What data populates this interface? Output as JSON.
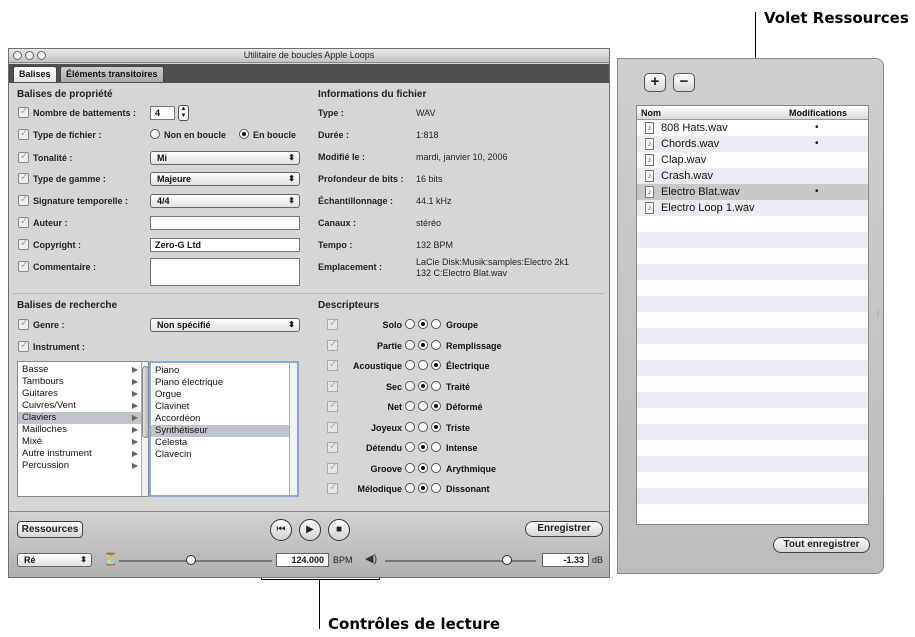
{
  "callouts": {
    "resources": "Volet Ressources",
    "playback": "Contrôles de lecture"
  },
  "window": {
    "title": "Utilitaire de boucles Apple Loops",
    "tabs": [
      "Balises",
      "Éléments transitoires"
    ]
  },
  "property_tags": {
    "title": "Balises de propriété",
    "beats_label": "Nombre de battements :",
    "beats_value": "4",
    "file_type_label": "Type de fichier :",
    "file_type_opt1": "Non en boucle",
    "file_type_opt2": "En boucle",
    "key_label": "Tonalité :",
    "key_value": "Mi",
    "scale_label": "Type de gamme :",
    "scale_value": "Majeure",
    "time_sig_label": "Signature temporelle :",
    "time_sig_value": "4/4",
    "author_label": "Auteur :",
    "author_value": "",
    "copyright_label": "Copyright :",
    "copyright_value": "Zero-G Ltd",
    "comment_label": "Commentaire :",
    "comment_value": ""
  },
  "file_info": {
    "title": "Informations du fichier",
    "rows": [
      {
        "label": "Type :",
        "value": "WAV"
      },
      {
        "label": "Durée :",
        "value": "1:818"
      },
      {
        "label": "Modifié le :",
        "value": "mardi, janvier 10, 2006"
      },
      {
        "label": "Profondeur de bits :",
        "value": "16 bits"
      },
      {
        "label": "Échantillonnage :",
        "value": "44.1 kHz"
      },
      {
        "label": "Canaux :",
        "value": "stéréo"
      },
      {
        "label": "Tempo :",
        "value": "132 BPM"
      }
    ],
    "location_label": "Emplacement :",
    "location_line1": "LaCie Disk:Musik:samples:Electro 2k1",
    "location_line2": "132 C:Electro Blat.wav"
  },
  "search_tags": {
    "title": "Balises de recherche",
    "genre_label": "Genre :",
    "genre_value": "Non spécifié",
    "instrument_label": "Instrument :",
    "categories": [
      "Basse",
      "Tambours",
      "Guitares",
      "Cuivres/Vent",
      "Claviers",
      "Mailloches",
      "Mixé",
      "Autre instrument",
      "Percussion"
    ],
    "selected_category": "Claviers",
    "instruments": [
      "Piano",
      "Piano électrique",
      "Orgue",
      "Clavinet",
      "Accordéon",
      "Synthétiseur",
      "Célesta",
      "Clavecin"
    ],
    "selected_instrument": "Synthétiseur"
  },
  "descriptors": {
    "title": "Descripteurs",
    "rows": [
      {
        "left": "Solo",
        "right": "Groupe",
        "selected": "middle"
      },
      {
        "left": "Partie",
        "right": "Remplissage",
        "selected": "middle"
      },
      {
        "left": "Acoustique",
        "right": "Électrique",
        "selected": "right"
      },
      {
        "left": "Sec",
        "right": "Traité",
        "selected": "middle"
      },
      {
        "left": "Net",
        "right": "Déformé",
        "selected": "right"
      },
      {
        "left": "Joyeux",
        "right": "Triste",
        "selected": "right"
      },
      {
        "left": "Détendu",
        "right": "Intense",
        "selected": "middle"
      },
      {
        "left": "Groove",
        "right": "Arythmique",
        "selected": "middle"
      },
      {
        "left": "Mélodique",
        "right": "Dissonant",
        "selected": "middle"
      }
    ]
  },
  "bottom": {
    "resources_button": "Ressources",
    "save_button": "Enregistrer",
    "key_popup": "Ré",
    "tempo_value": "124.000",
    "tempo_unit": "BPM",
    "tempo_level": 0.45,
    "volume_value": "-1.33",
    "volume_unit": "dB",
    "volume_level": 0.8
  },
  "resources": {
    "col_name": "Nom",
    "col_mod": "Modifications",
    "files": [
      {
        "name": "808 Hats.wav",
        "mod": "•"
      },
      {
        "name": "Chords.wav",
        "mod": "•"
      },
      {
        "name": "Clap.wav",
        "mod": ""
      },
      {
        "name": "Crash.wav",
        "mod": ""
      },
      {
        "name": "Electro Blat.wav",
        "mod": "•"
      },
      {
        "name": "Electro Loop 1.wav",
        "mod": ""
      }
    ],
    "selected_index": 4,
    "save_all_button": "Tout enregistrer"
  }
}
